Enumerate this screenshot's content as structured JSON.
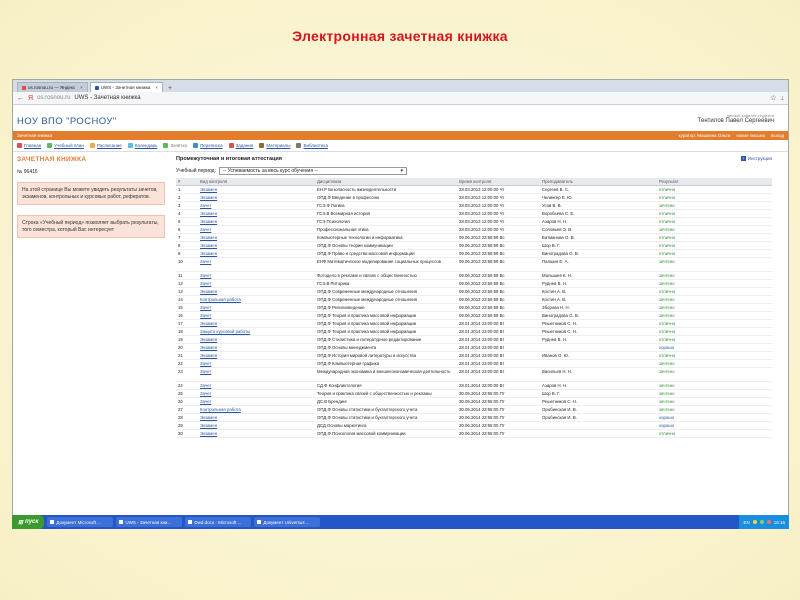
{
  "slide_title": "Электронная зачетная книжка",
  "browser": {
    "tabs": [
      {
        "label": "os.rosnou.ru — Яндекс"
      },
      {
        "label": "UWS - Зачетная книжка"
      }
    ],
    "new_tab": "+",
    "back": "←",
    "refresh": "Я",
    "url_domain": "os.rosnou.ru",
    "page_title": "UWS - Зачетная книжка",
    "star": "☆",
    "download": "↓"
  },
  "site": {
    "logo": "НОУ ВПО \"РОСНОУ\"",
    "cabinet_label": "личный кабинет студента",
    "user_name": "Тентилов Павел Сергеевич",
    "section": "Зачетная книжка",
    "curator": "куратор: Машкина Ольга",
    "mail": "новое письмо",
    "exit": "выход"
  },
  "menu": [
    {
      "label": "Главная",
      "color": "#d9534f"
    },
    {
      "label": "Учебный план",
      "color": "#5cb85c"
    },
    {
      "label": "Расписание",
      "color": "#f0ad4e"
    },
    {
      "label": "Календарь",
      "color": "#5bc0de"
    },
    {
      "label": "Зачётка",
      "color": "#5cb85c",
      "active": true
    },
    {
      "label": "Переписка",
      "color": "#428bca"
    },
    {
      "label": "Задания",
      "color": "#d9534f"
    },
    {
      "label": "Материалы",
      "color": "#8a6d3b"
    },
    {
      "label": "Библиотека",
      "color": "#777777"
    }
  ],
  "sidebar": {
    "title": "ЗАЧЕТНАЯ КНИЖКА",
    "number": "№ 96416",
    "note1": "На этой странице Вы можете увидеть результаты зачетов, экзаменов, контрольных и курсовых работ, рефератов.",
    "note2": "Строка «Учебный период» позволяет выбрать результаты, того семестра, который Вас интересует"
  },
  "main": {
    "title": "Промежуточная и итоговая аттестация",
    "instruction": "Инструкция",
    "period_label": "Учебный период:",
    "period_value": "-- Успеваемость за весь курс обучения --",
    "headers": [
      "#",
      "Вид контроля",
      "Дисциплина",
      "Время контроля",
      "Преподаватель",
      "Результат"
    ]
  },
  "rows": [
    [
      "1",
      "Экзамен",
      "ЕН.Р Безопасность жизнедеятельности",
      "28.03.2013 12:00:00 Чт",
      "Сергеев В. С.",
      "отлично",
      "g"
    ],
    [
      "2",
      "Экзамен",
      "ОПД.Ф Введение в профессию",
      "28.03.2013 12:00:00 Чт",
      "Челингер Е. Ю.",
      "отлично",
      "g"
    ],
    [
      "3",
      "Зачет",
      "ГСЭ.Ф Логика",
      "28.03.2013 12:00:00 Чт",
      "Усов В. В.",
      "зачтено",
      "g"
    ],
    [
      "4",
      "Экзамен",
      "ГСЭ.В Всемирная история",
      "28.03.2013 12:00:00 Чт",
      "Воробьева С. Е.",
      "отлично",
      "g"
    ],
    [
      "5",
      "Экзамен",
      "ГСЭ Психология",
      "28.03.2013 12:00:00 Чт",
      "Азаров Н. Н.",
      "отлично",
      "g"
    ],
    [
      "6",
      "Зачет",
      "Профессиональная этика",
      "28.03.2013 12:00:00 Чт",
      "Соловьев Э. В.",
      "зачтено",
      "g"
    ],
    [
      "7",
      "Экзамен",
      "Компьютерные технологии и информатика",
      "09.06.2013 23:59:59 Вс",
      "Батманова О. В.",
      "отлично",
      "g"
    ],
    [
      "8",
      "Экзамен",
      "ОПД.Ф Основы теории коммуникации",
      "09.06.2013 23:59:59 Вс",
      "Шор В. Г.",
      "отлично",
      "g"
    ],
    [
      "9",
      "Экзамен",
      "ОПД.Ф Право и средства массовой информации",
      "09.06.2013 23:59:59 Вс",
      "Виноградова О. В.",
      "отлично",
      "g"
    ],
    [
      "10",
      "Зачет",
      "ЕНФ Математическое моделирование социальных процессов",
      "09.06.2013 23:59:59 Вс",
      "Палшин Е. А.",
      "зачтено",
      "g",
      "tall"
    ],
    [
      "11",
      "Зачет",
      "Фотодело в рекламе и связях с общественностью",
      "09.06.2013 23:59:59 Вс",
      "Малышев К. Н.",
      "зачтено",
      "g"
    ],
    [
      "12",
      "Зачет",
      "ГСЭ.В Риторика",
      "09.06.2013 23:59:59 Вс",
      "Руднев В. Н.",
      "зачтено",
      "g"
    ],
    [
      "13",
      "Экзамен",
      "ОПД.Ф Современные международные отношения",
      "09.06.2013 23:59:59 Вс",
      "Костин А. В.",
      "отлично",
      "g"
    ],
    [
      "14",
      "Контрольная работа",
      "ОПД.Ф Современные международные отношения",
      "09.06.2013 23:59:59 Вс",
      "Костин А. В.",
      "зачтено",
      "g"
    ],
    [
      "15",
      "Зачет",
      "ОПД.Ф Религиоведение",
      "09.06.2013 23:59:59 Вс",
      "Зборова Н. Н.",
      "зачтено",
      "g"
    ],
    [
      "16",
      "Зачет",
      "ОПД.Ф Теория и практика массовой информации",
      "09.06.2013 23:59:59 Вс",
      "Виноградова О. В.",
      "зачтено",
      "g"
    ],
    [
      "17",
      "Экзамен",
      "ОПД.Ф Теория и практика массовой информации",
      "28.01.2014 23:00:00 Вт",
      "Решетников С. Н.",
      "отлично",
      "g"
    ],
    [
      "18",
      "Защита курсовой работы",
      "ОПД.Ф Теория и практика массовой информации",
      "28.01.2014 23:00:00 Вт",
      "Решетников С. Н.",
      "отлично",
      "g"
    ],
    [
      "19",
      "Экзамен",
      "ОПД.Ф Стилистика и литературное редактирование",
      "28.01.2014 23:00:00 Вт",
      "Руднев В. Н.",
      "отлично",
      "g"
    ],
    [
      "20",
      "Экзамен",
      "ОПД.Ф Основы менеджмента",
      "28.01.2014 23:00:00 Вт",
      "",
      "хорошо",
      "b"
    ],
    [
      "21",
      "Экзамен",
      "ОПД.Ф История мировой литературы и искусства",
      "28.01.2014 23:00:00 Вт",
      "Иванов О. Ю.",
      "отлично",
      "g"
    ],
    [
      "22",
      "Зачет",
      "ОПД.Ф Компьютерная графика",
      "28.01.2014 23:00:00 Вт",
      "",
      "зачтено",
      "g"
    ],
    [
      "23",
      "Зачет",
      "Международная экономика и внешнеэкономическая деятельность",
      "28.01.2014 23:00:00 Вт",
      "Васильев Н. Н.",
      "зачтено",
      "g",
      "tall"
    ],
    [
      "24",
      "Зачет",
      "СД.Ф Конфликтология",
      "28.01.2014 23:00:00 Вт",
      "Азаров Н. Н.",
      "зачтено",
      "g"
    ],
    [
      "25",
      "Зачет",
      "Теория и практика связей с общественностью и рекламы",
      "30.05.2014 23:55:00 Пт",
      "Шор В. Г.",
      "зачтено",
      "g"
    ],
    [
      "26",
      "Зачет",
      "ДС.В Брендинг",
      "30.05.2014 23:55:00 Пт",
      "Решетников С. Н.",
      "зачтено",
      "g"
    ],
    [
      "27",
      "Контрольная работа",
      "ОПД.Ф Основы статистики и бухгалтерского учета",
      "30.05.2014 23:55:00 Пт",
      "Оробинская И. В.",
      "зачтено",
      "g"
    ],
    [
      "28",
      "Экзамен",
      "ОПД.Ф Основы статистики и бухгалтерского учета",
      "20.06.2014 23:55:00 Пт",
      "Оробинская И. В.",
      "хорошо",
      "b"
    ],
    [
      "29",
      "Экзамен",
      "ДСД Основы маркетинга",
      "20.06.2014 23:55:00 Пт",
      "",
      "хорошо",
      "b"
    ],
    [
      "30",
      "Экзамен",
      "ОПД.Ф Психология массовой коммуникации",
      "20.06.2014 23:55:00 Пт",
      "",
      "отлично",
      "g"
    ]
  ],
  "taskbar": {
    "start": "пуск",
    "items": [
      "Документ Microsoft ...",
      "UWS - Зачетная кни...",
      "Dwd.docx - Microsoft ...",
      "Документ Universus ..."
    ],
    "lang": "EN",
    "clock": "16:16"
  }
}
